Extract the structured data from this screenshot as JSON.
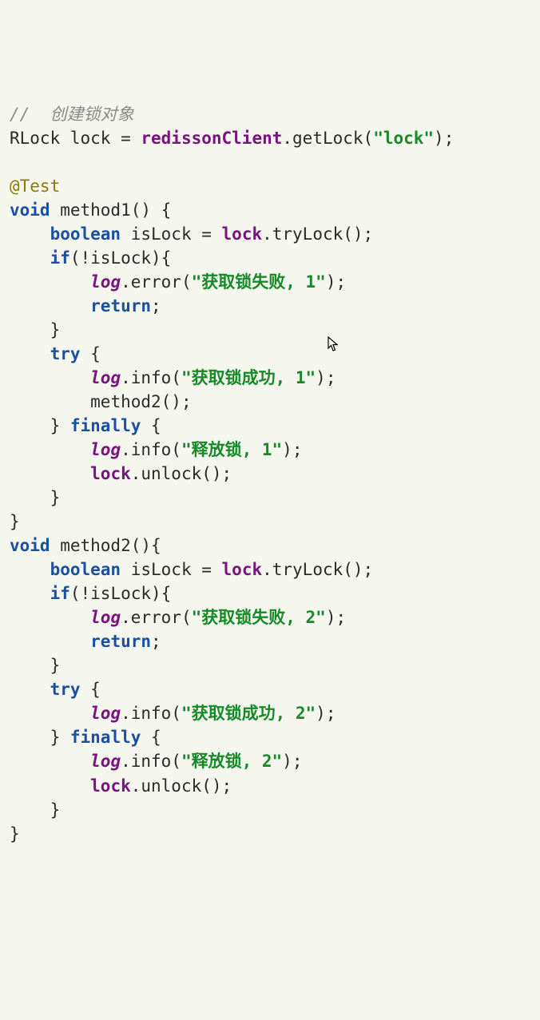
{
  "code": {
    "comment": "//  创建锁对象",
    "l2a": "RLock lock = ",
    "l2b": "redissonClient",
    "l2c": ".getLock(",
    "l2d": "\"lock\"",
    "l2e": ");",
    "annotation": "@Test",
    "kw_void": "void",
    "m1_sig": " method1() {",
    "indent1": "    ",
    "indent2": "        ",
    "kw_boolean": "boolean",
    "islock_eq": " isLock = ",
    "lock_id": "lock",
    "trylock_tail": ".tryLock();",
    "kw_if": "if",
    "if_cond": "(!isLock){",
    "log_id": "log",
    "err_call_open": ".error(",
    "str_fail1": "\"获取锁失败, 1\"",
    "call_close": ");",
    "kw_return": "return",
    "semi": ";",
    "brace_close": "}",
    "kw_try": "try",
    "open_brace": " {",
    "info_call_open": ".info(",
    "str_succ1": "\"获取锁成功, 1\"",
    "m2_call": "method2();",
    "try_close_finally": "} ",
    "kw_finally": "finally",
    "str_rel1": "\"释放锁, 1\"",
    "unlock_tail": ".unlock();",
    "m2_sig": " method2(){",
    "str_fail2": "\"获取锁失败, 2\"",
    "str_succ2": "\"获取锁成功, 2\"",
    "str_rel2": "\"释放锁, 2\""
  },
  "cursor_glyph": "↖"
}
